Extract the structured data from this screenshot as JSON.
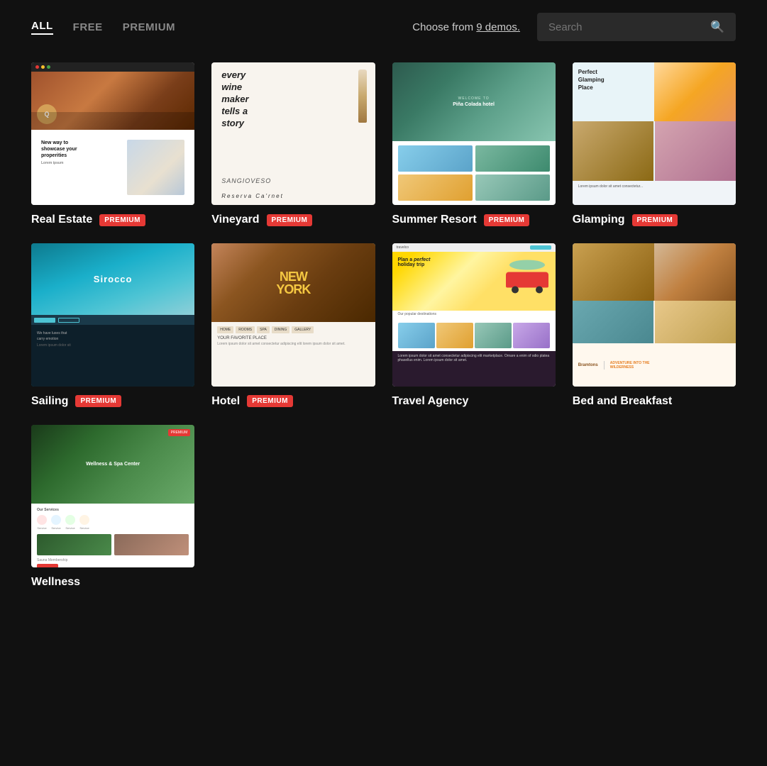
{
  "topBar": {
    "filters": [
      {
        "id": "all",
        "label": "ALL",
        "active": true
      },
      {
        "id": "free",
        "label": "FREE",
        "active": false
      },
      {
        "id": "premium",
        "label": "PREMIUM",
        "active": false
      }
    ],
    "chooseText": "Choose from",
    "demosCount": "9 demos.",
    "search": {
      "placeholder": "Search",
      "value": ""
    }
  },
  "demos": [
    {
      "id": "real-estate",
      "name": "Real Estate",
      "badge": "PREMIUM",
      "hasBadge": true
    },
    {
      "id": "vineyard",
      "name": "Vineyard",
      "badge": "PREMIUM",
      "hasBadge": true
    },
    {
      "id": "summer-resort",
      "name": "Summer Resort",
      "badge": "PREMIUM",
      "hasBadge": true
    },
    {
      "id": "glamping",
      "name": "Glamping",
      "badge": "PREMIUM",
      "hasBadge": true
    },
    {
      "id": "sailing",
      "name": "Sailing",
      "badge": "PREMIUM",
      "hasBadge": true
    },
    {
      "id": "hotel",
      "name": "Hotel",
      "badge": "PREMIUM",
      "hasBadge": true
    },
    {
      "id": "travel-agency",
      "name": "Travel Agency",
      "badge": null,
      "hasBadge": false
    },
    {
      "id": "bed-and-breakfast",
      "name": "Bed and Breakfast",
      "badge": null,
      "hasBadge": false
    },
    {
      "id": "wellness",
      "name": "Wellness",
      "badge": null,
      "hasBadge": false
    }
  ]
}
